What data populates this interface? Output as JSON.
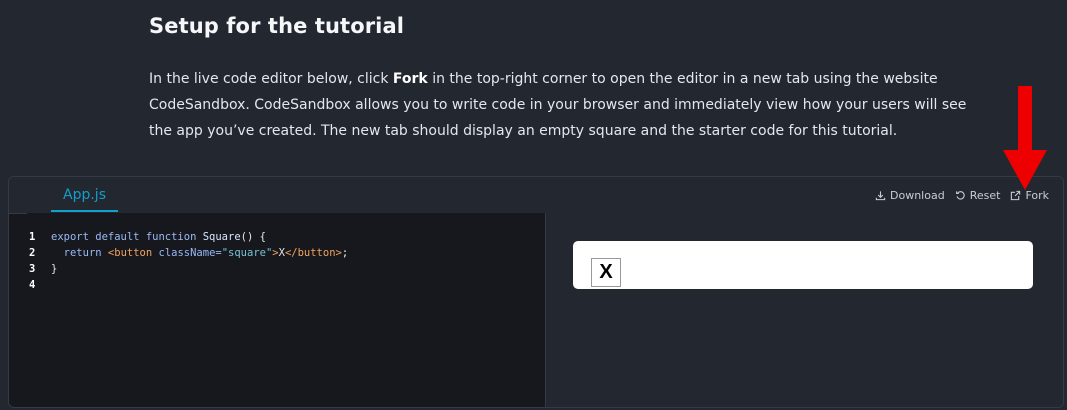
{
  "section": {
    "title": "Setup for the tutorial",
    "intro_part1": "In the live code editor below, click ",
    "intro_bold": "Fork",
    "intro_part2": " in the top-right corner to open the editor in a new tab using the website CodeSandbox. CodeSandbox allows you to write code in your browser and immediately view how your users will see the app you’ve created. The new tab should display an empty square and the starter code for this tutorial."
  },
  "sandbox": {
    "file_tab": "App.js",
    "actions": {
      "download_label": "Download",
      "reset_label": "Reset",
      "fork_label": "Fork"
    },
    "code": {
      "line_numbers": [
        "1",
        "2",
        "3",
        "4"
      ],
      "line1": {
        "kw": "export default function ",
        "fn": "Square",
        "rest": "() {"
      },
      "line2": {
        "indent": "  ",
        "kw": "return ",
        "tag_open": "<button ",
        "attr": "className=",
        "str": "\"square\"",
        "tag_close": ">",
        "text": "X",
        "end_tag": "</button>",
        "semi": ";"
      },
      "line3": "}",
      "line4": ""
    },
    "preview": {
      "square_label": "X"
    }
  },
  "colors": {
    "background": "#23272f",
    "accent": "#149eca",
    "arrow": "#ee0000"
  },
  "icons": {
    "download": "download-icon",
    "reset": "reset-icon",
    "fork": "external-link-icon",
    "annotation": "red-down-arrow"
  }
}
